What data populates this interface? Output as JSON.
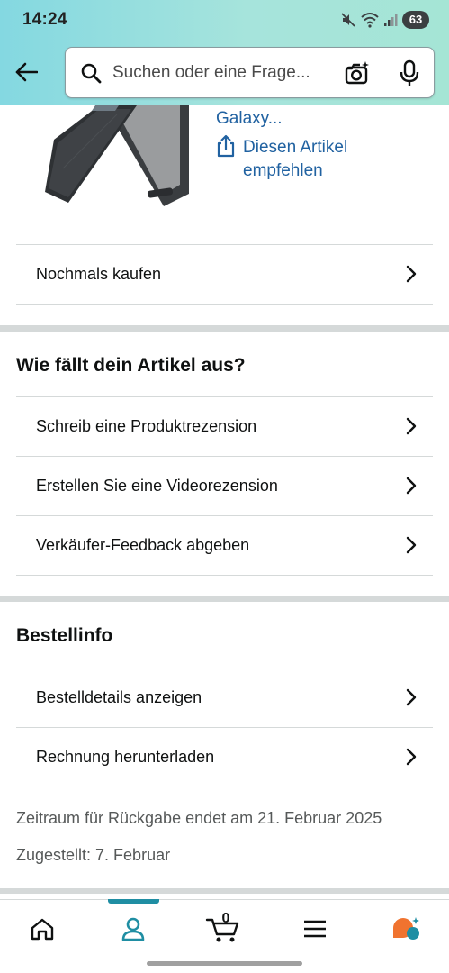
{
  "status_bar": {
    "time": "14:24",
    "battery": "63"
  },
  "search": {
    "placeholder": "Suchen oder eine Frage..."
  },
  "product": {
    "title_tail": "Galaxy...",
    "share_label": "Diesen Artikel empfehlen"
  },
  "buy_again": {
    "label": "Nochmals kaufen"
  },
  "review_section": {
    "title": "Wie fällt dein Artikel aus?",
    "items": [
      {
        "label": "Schreib eine Produktrezension"
      },
      {
        "label": "Erstellen Sie eine Videorezension"
      },
      {
        "label": "Verkäufer-Feedback abgeben"
      }
    ]
  },
  "order_info": {
    "title": "Bestellinfo",
    "items": [
      {
        "label": "Bestelldetails anzeigen"
      },
      {
        "label": "Rechnung herunterladen"
      }
    ],
    "return_window": "Zeitraum für Rückgabe endet am 21. Februar 2025",
    "delivered": "Zugestellt: 7. Februar"
  },
  "bottom_nav": {
    "items": [
      {
        "icon": "home-icon"
      },
      {
        "icon": "account-icon"
      },
      {
        "icon": "cart-icon"
      },
      {
        "icon": "menu-icon"
      },
      {
        "icon": "rufus-assistant-icon"
      }
    ],
    "active": "account-icon",
    "cart_count": "0"
  },
  "colors": {
    "accent": "#1f8ea3",
    "link": "#2162a1",
    "header_start": "#84d8e1",
    "header_end": "#a5e5d5",
    "assistant_orange": "#f0732f",
    "assistant_teal": "#1f8ea3"
  }
}
